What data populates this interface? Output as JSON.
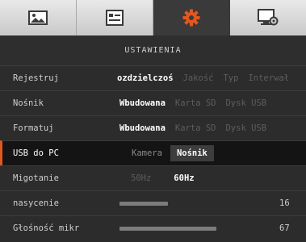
{
  "tabs": [
    {
      "icon": "image-icon",
      "active": false
    },
    {
      "icon": "video-settings-icon",
      "active": false
    },
    {
      "icon": "gear-icon",
      "active": true
    },
    {
      "icon": "monitor-settings-icon",
      "active": false
    }
  ],
  "colors": {
    "accent": "#e2571e",
    "selected_bg": "#141414"
  },
  "header": {
    "title": "USTAWIENIA"
  },
  "rows": {
    "rejestruj": {
      "label": "Rejestruj",
      "options": [
        "ozdzielczoś",
        "Jakość",
        "Typ",
        "Interwał"
      ],
      "selected": 0
    },
    "nosnik": {
      "label": "Nośnik",
      "options": [
        "Wbudowana",
        "Karta SD",
        "Dysk USB"
      ],
      "selected": 0
    },
    "formatuj": {
      "label": "Formatuj",
      "options": [
        "Wbudowana",
        "Karta SD",
        "Dysk USB"
      ],
      "selected": 0
    },
    "usb": {
      "label": "USB do PC",
      "options": [
        "Kamera",
        "Nośnik"
      ],
      "selected": 1
    },
    "migotanie": {
      "label": "Migotanie",
      "options": [
        "50Hz",
        "60Hz"
      ],
      "selected": 1
    },
    "nasycenie": {
      "label": "nasycenie",
      "value": "16",
      "level": 0.16
    },
    "glosnosc": {
      "label": "Głośność mikr",
      "value": "67",
      "level": 0.67
    }
  }
}
